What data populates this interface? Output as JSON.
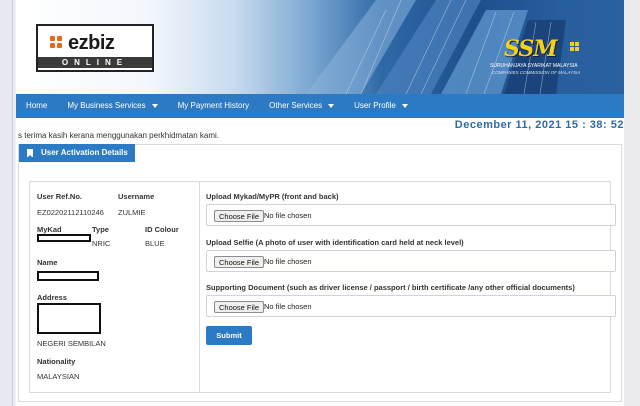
{
  "banner": {
    "logo_main": "ezbiz",
    "logo_sub": "ONLINE",
    "ssm_mark": "SSM",
    "ssm_line1": "SURUHANJAYA SYARIKAT MALAYSIA",
    "ssm_line2": "COMPANIES COMMISSION OF MALAYSIA"
  },
  "nav": {
    "items": [
      {
        "label": "Home",
        "dropdown": false
      },
      {
        "label": "My Business Services",
        "dropdown": true
      },
      {
        "label": "My Payment History",
        "dropdown": false
      },
      {
        "label": "Other Services",
        "dropdown": true
      },
      {
        "label": "User Profile",
        "dropdown": true
      }
    ]
  },
  "welcome_text": "s terima kasih kerana menggunakan perkhidmatan kami.",
  "datetime": "December 11, 2021 15 : 38: 52",
  "panel": {
    "title": "User Activation Details",
    "icon": "bookmark-icon"
  },
  "user": {
    "ref_label": "User Ref.No.",
    "ref_value": "EZ02202112110246",
    "username_label": "Username",
    "username_value": "ZULMIE",
    "mykad_label": "MyKad",
    "type_label": "Type",
    "type_value": "NRIC",
    "id_colour_label": "ID Colour",
    "id_colour_value": "BLUE",
    "name_label": "Name",
    "address_label": "Address",
    "address_state": "NEGERI SEMBILAN",
    "nationality_label": "Nationality",
    "nationality_value": "MALAYSIAN"
  },
  "uploads": {
    "mykad_label": "Upload Mykad/MyPR (front and back)",
    "selfie_label": "Upload Selfie (A photo of user with identification card held at neck level)",
    "supporting_label": "Supporting Document (such as driver license / passport / birth certificate /any other official documents)",
    "choose_label": "Choose File",
    "no_file_label": "No file chosen",
    "submit_label": "Submit"
  },
  "colors": {
    "accent": "#2c7ac3",
    "datetime": "#2f6aa5",
    "logo_orange": "#e36b1b",
    "ssm_yellow": "#f1d21a"
  }
}
